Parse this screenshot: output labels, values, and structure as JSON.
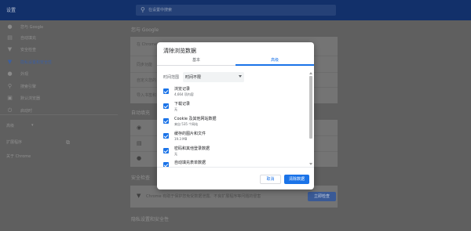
{
  "header": {
    "title": "设置",
    "search_placeholder": "在设置中搜索",
    "search_icon": "search-icon"
  },
  "sidebar": {
    "items": [
      {
        "label": "您与 Google",
        "icon": "person-icon"
      },
      {
        "label": "自动填充",
        "icon": "clipboard-icon"
      },
      {
        "label": "安全检查",
        "icon": "shield-icon"
      },
      {
        "label": "隐私设置和安全性",
        "icon": "shield-lock-icon",
        "active": true
      },
      {
        "label": "外观",
        "icon": "palette-icon"
      },
      {
        "label": "搜索引擎",
        "icon": "search-icon"
      },
      {
        "label": "默认浏览器",
        "icon": "browser-icon"
      },
      {
        "label": "启动时",
        "icon": "power-icon"
      }
    ],
    "advanced_label": "高级",
    "extensions_label": "扩展程序",
    "about_label": "关于 Chrome"
  },
  "background": {
    "section_you_google": "您与 Google",
    "sync_prefix": "在 Chrome",
    "row_sync": "同步功能",
    "row_customize": "自定义您的",
    "row_import": "导入书签和",
    "section_autofill": "自动填充",
    "section_safety": "安全检查",
    "safety_text": "Chrome 有助于保护您免受数据泄露、不良扩展程序等问题的侵害",
    "safety_button": "立即检查",
    "section_privacy": "隐私设置和安全性"
  },
  "dialog": {
    "title": "清除浏览数据",
    "tabs": [
      {
        "label": "基本",
        "selected": false
      },
      {
        "label": "高级",
        "selected": true
      }
    ],
    "time_range_label": "时间范围",
    "time_range_value": "时间不限",
    "items": [
      {
        "label": "浏览记录",
        "detail": "4,664 项内容",
        "checked": true
      },
      {
        "label": "下载记录",
        "detail": "无",
        "checked": true
      },
      {
        "label": "Cookie 及其他网站数据",
        "detail": "来自 535 个网站",
        "checked": true
      },
      {
        "label": "缓存的图片和文件",
        "detail": "19.3 MB",
        "checked": true
      },
      {
        "label": "密码和其他登录数据",
        "detail": "无",
        "checked": true
      },
      {
        "label": "自动填充表单数据",
        "detail": "",
        "checked": true
      }
    ],
    "cancel_label": "取消",
    "clear_label": "清除数据"
  },
  "colors": {
    "accent": "#1a73e8",
    "header_bg_dimmed": "#12306a",
    "page_bg_dimmed": "#5f5f5f"
  }
}
